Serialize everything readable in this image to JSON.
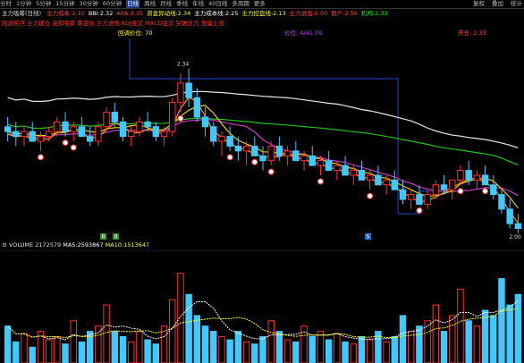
{
  "toolbar": {
    "periods": [
      "分时",
      "1分钟",
      "5分钟",
      "15分钟",
      "30分钟",
      "60分钟",
      "日线",
      "周线",
      "月线",
      "季线",
      "年线",
      "40日线",
      "多周期",
      "更多"
    ],
    "active_period": "日线",
    "right_buttons": [
      "复权",
      "叠加",
      "统计"
    ]
  },
  "indicator_line": {
    "name": "主力吸筹(日线)",
    "items": [
      {
        "label": "主力成本:",
        "value": "2.10",
        "color": "#ff4040"
      },
      {
        "label": "BBI:",
        "value": "2.32",
        "color": "#ffffff"
      },
      {
        "label": "AR6:",
        "value": "2.35",
        "color": "#ff4040"
      },
      {
        "label": "资金异动线:",
        "value": "2.34",
        "color": "#ffff00"
      },
      {
        "label": "主力成本线:",
        "value": "2.25",
        "color": "#ffffff"
      },
      {
        "label": "主力控盘线:",
        "value": "2.13",
        "color": "#ffff00"
      },
      {
        "label": "主力进出:",
        "value": "0.00",
        "color": "#ff4040"
      },
      {
        "label": "散户:",
        "value": "2.50",
        "color": "#ff4040"
      },
      {
        "label": "机构:",
        "value": "2.33",
        "color": "#00ff00"
      }
    ]
  },
  "signal_line": "回调买点 主力建仓 底部吸筹 黄金坑 主力进场 KDJ金叉 MACD金叉 突破压力 放量上涨",
  "price_labels": {
    "left": "回调价位: 70",
    "center": "价位: 4/41.79",
    "right": "开仓: 2.33"
  },
  "chart_labels": {
    "high_price": "2.34",
    "low_price": "2.00",
    "marker_a": "B",
    "marker_b": "B",
    "marker_c": "S"
  },
  "volume_header": {
    "name": "VOLUME",
    "volume": "2172579",
    "ma5_label": "MA5:",
    "ma5": "2593867",
    "ma10_label": "MA10:",
    "ma10": "1513647"
  },
  "colors": {
    "up": "#ff3030",
    "down": "#3ec9ff",
    "ma_white": "#e8e8e8",
    "ma_green": "#20c020",
    "ma_yellow": "#f0d000",
    "ma_purple": "#c040c0",
    "ma_orange": "#ff9020",
    "blue_line": "#2244cc"
  },
  "chart_data": {
    "type": "candlestick",
    "candles": [
      [
        2.22,
        2.24,
        2.19,
        2.21
      ],
      [
        2.21,
        2.23,
        2.18,
        2.2
      ],
      [
        2.2,
        2.22,
        2.18,
        2.21
      ],
      [
        2.21,
        2.23,
        2.19,
        2.19
      ],
      [
        2.19,
        2.21,
        2.17,
        2.2
      ],
      [
        2.2,
        2.22,
        2.19,
        2.21
      ],
      [
        2.21,
        2.24,
        2.2,
        2.23
      ],
      [
        2.23,
        2.25,
        2.2,
        2.21
      ],
      [
        2.21,
        2.23,
        2.19,
        2.22
      ],
      [
        2.22,
        2.24,
        2.2,
        2.2
      ],
      [
        2.2,
        2.22,
        2.18,
        2.19
      ],
      [
        2.19,
        2.23,
        2.18,
        2.22
      ],
      [
        2.22,
        2.26,
        2.21,
        2.25
      ],
      [
        2.25,
        2.27,
        2.22,
        2.23
      ],
      [
        2.23,
        2.24,
        2.19,
        2.2
      ],
      [
        2.2,
        2.22,
        2.18,
        2.21
      ],
      [
        2.21,
        2.24,
        2.2,
        2.23
      ],
      [
        2.23,
        2.25,
        2.21,
        2.22
      ],
      [
        2.22,
        2.23,
        2.19,
        2.2
      ],
      [
        2.2,
        2.22,
        2.18,
        2.21
      ],
      [
        2.21,
        2.28,
        2.2,
        2.27
      ],
      [
        2.27,
        2.33,
        2.25,
        2.31
      ],
      [
        2.31,
        2.34,
        2.26,
        2.28
      ],
      [
        2.28,
        2.3,
        2.23,
        2.24
      ],
      [
        2.24,
        2.26,
        2.2,
        2.22
      ],
      [
        2.22,
        2.23,
        2.18,
        2.19
      ],
      [
        2.19,
        2.21,
        2.16,
        2.2
      ],
      [
        2.2,
        2.22,
        2.17,
        2.18
      ],
      [
        2.18,
        2.2,
        2.15,
        2.17
      ],
      [
        2.17,
        2.19,
        2.14,
        2.18
      ],
      [
        2.18,
        2.2,
        2.16,
        2.16
      ],
      [
        2.16,
        2.18,
        2.13,
        2.15
      ],
      [
        2.15,
        2.19,
        2.14,
        2.18
      ],
      [
        2.18,
        2.2,
        2.15,
        2.16
      ],
      [
        2.16,
        2.18,
        2.14,
        2.17
      ],
      [
        2.17,
        2.19,
        2.15,
        2.15
      ],
      [
        2.15,
        2.17,
        2.13,
        2.16
      ],
      [
        2.16,
        2.18,
        2.14,
        2.14
      ],
      [
        2.14,
        2.16,
        2.12,
        2.15
      ],
      [
        2.15,
        2.17,
        2.13,
        2.13
      ],
      [
        2.13,
        2.15,
        2.11,
        2.14
      ],
      [
        2.14,
        2.16,
        2.12,
        2.12
      ],
      [
        2.12,
        2.14,
        2.1,
        2.13
      ],
      [
        2.13,
        2.15,
        2.11,
        2.11
      ],
      [
        2.11,
        2.13,
        2.09,
        2.12
      ],
      [
        2.12,
        2.14,
        2.1,
        2.1
      ],
      [
        2.1,
        2.12,
        2.08,
        2.11
      ],
      [
        2.11,
        2.13,
        2.09,
        2.09
      ],
      [
        2.09,
        2.11,
        2.06,
        2.07
      ],
      [
        2.07,
        2.09,
        2.05,
        2.08
      ],
      [
        2.08,
        2.1,
        2.06,
        2.06
      ],
      [
        2.06,
        2.09,
        2.05,
        2.08
      ],
      [
        2.08,
        2.11,
        2.07,
        2.1
      ],
      [
        2.1,
        2.12,
        2.08,
        2.09
      ],
      [
        2.09,
        2.11,
        2.07,
        2.11
      ],
      [
        2.11,
        2.14,
        2.1,
        2.13
      ],
      [
        2.13,
        2.15,
        2.1,
        2.11
      ],
      [
        2.11,
        2.13,
        2.09,
        2.12
      ],
      [
        2.12,
        2.14,
        2.1,
        2.1
      ],
      [
        2.1,
        2.12,
        2.07,
        2.08
      ],
      [
        2.08,
        2.09,
        2.04,
        2.05
      ],
      [
        2.05,
        2.07,
        2.01,
        2.02
      ],
      [
        2.02,
        2.04,
        2.0,
        2.01
      ]
    ],
    "volumes": [
      0.35,
      0.2,
      0.28,
      0.15,
      0.3,
      0.22,
      0.25,
      0.18,
      0.4,
      0.2,
      0.3,
      0.35,
      0.55,
      0.3,
      0.25,
      0.2,
      0.3,
      0.22,
      0.18,
      0.35,
      0.6,
      0.85,
      0.65,
      0.45,
      0.35,
      0.3,
      0.25,
      0.22,
      0.3,
      0.2,
      0.18,
      0.25,
      0.4,
      0.3,
      0.22,
      0.2,
      0.35,
      0.25,
      0.3,
      0.22,
      0.28,
      0.2,
      0.18,
      0.25,
      0.22,
      0.3,
      0.2,
      0.25,
      0.45,
      0.3,
      0.35,
      0.4,
      0.55,
      0.3,
      0.45,
      0.7,
      0.4,
      0.35,
      0.5,
      0.45,
      0.8,
      0.55,
      0.65
    ],
    "ylim": [
      2.0,
      2.38
    ]
  }
}
